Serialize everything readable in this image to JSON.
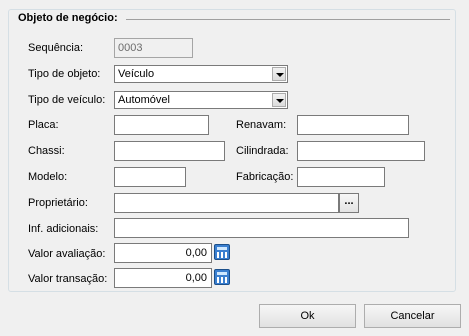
{
  "group": {
    "title": "Objeto de negócio:"
  },
  "fields": {
    "sequencia": {
      "label": "Sequência:",
      "value": "0003"
    },
    "tipo_objeto": {
      "label": "Tipo de objeto:",
      "value": "Veículo"
    },
    "tipo_veiculo": {
      "label": "Tipo de veículo:",
      "value": "Automóvel"
    },
    "placa": {
      "label": "Placa:",
      "value": ""
    },
    "renavam": {
      "label": "Renavam:",
      "value": ""
    },
    "chassi": {
      "label": "Chassi:",
      "value": ""
    },
    "cilindrada": {
      "label": "Cilindrada:",
      "value": ""
    },
    "modelo": {
      "label": "Modelo:",
      "value": ""
    },
    "fabricacao": {
      "label": "Fabricação:",
      "value": ""
    },
    "proprietario": {
      "label": "Proprietário:",
      "value": "",
      "button_label": "..."
    },
    "inf_adicionais": {
      "label": "Inf. adicionais:",
      "value": ""
    },
    "valor_avaliacao": {
      "label": "Valor avaliação:",
      "value": "0,00"
    },
    "valor_transacao": {
      "label": "Valor transação:",
      "value": "0,00"
    }
  },
  "buttons": {
    "ok": "Ok",
    "cancel": "Cancelar"
  }
}
